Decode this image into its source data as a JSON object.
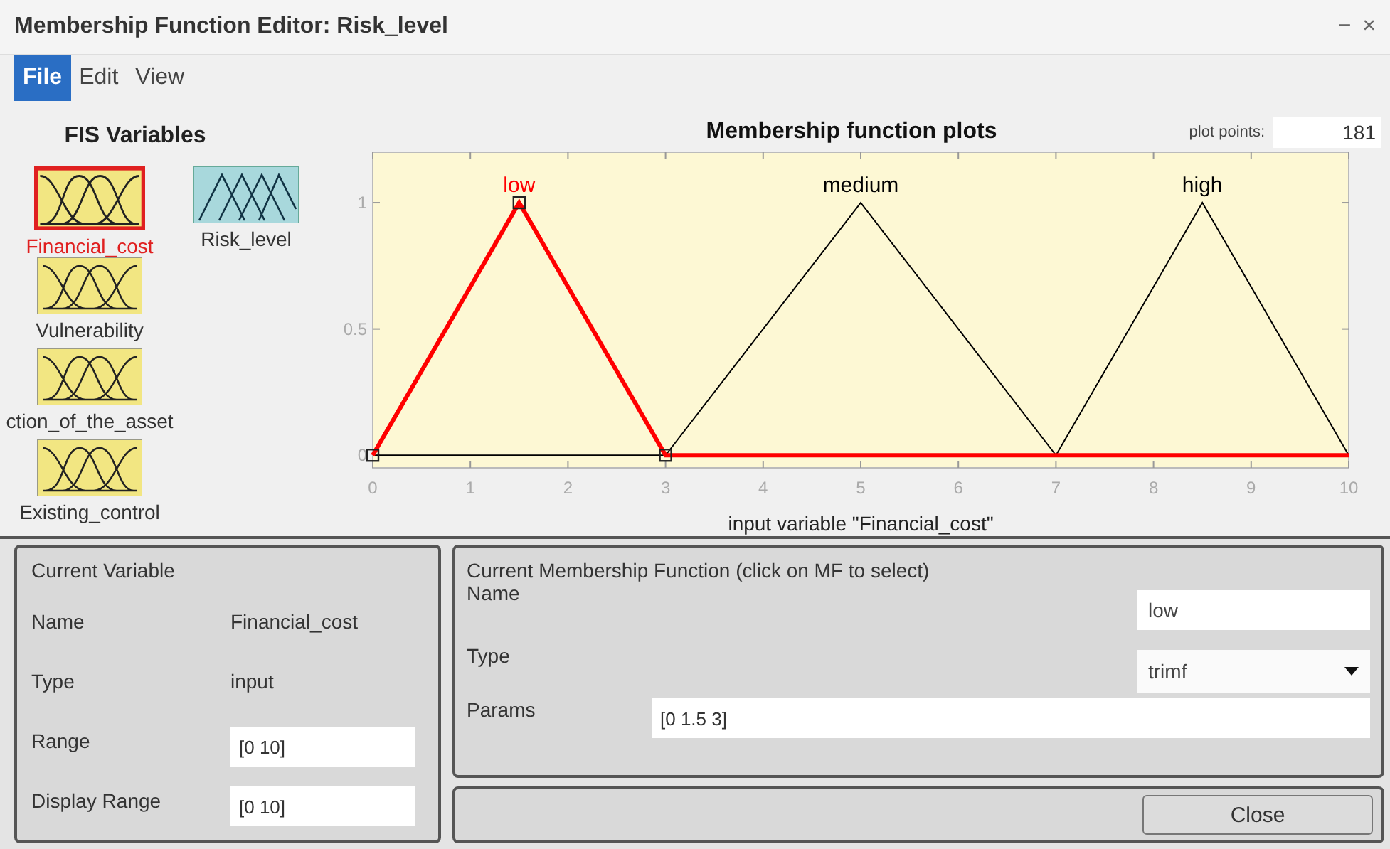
{
  "window": {
    "title": "Membership Function Editor: Risk_level",
    "controls": [
      "−",
      "×"
    ]
  },
  "menu": [
    {
      "label": "File",
      "selected": true
    },
    {
      "label": "Edit",
      "selected": false
    },
    {
      "label": "View",
      "selected": false
    }
  ],
  "fis_variables": {
    "title": "FIS Variables",
    "items": [
      {
        "name": "Financial_cost",
        "kind": "input",
        "selected": true
      },
      {
        "name": "Risk_level",
        "kind": "output",
        "selected": false
      },
      {
        "name": "Vulnerability",
        "kind": "input",
        "selected": false
      },
      {
        "name": "ction_of_the_asset",
        "kind": "input",
        "selected": false
      },
      {
        "name": "Existing_control",
        "kind": "input",
        "selected": false
      }
    ]
  },
  "plot": {
    "plot_points_label": "plot points:",
    "plot_points": "181",
    "chart_data": {
      "type": "line",
      "title": "Membership function plots",
      "xlabel": "input variable \"Financial_cost\"",
      "x": [
        0,
        1.5,
        3,
        5,
        7,
        8.5,
        10
      ],
      "series": [
        {
          "name": "low",
          "color": "#ff0000",
          "values": [
            0,
            1,
            0,
            0,
            0,
            0,
            0
          ]
        },
        {
          "name": "medium",
          "color": "#000000",
          "values": [
            null,
            null,
            0,
            1,
            0,
            null,
            null
          ]
        },
        {
          "name": "high",
          "color": "#000000",
          "values": [
            null,
            null,
            null,
            null,
            0,
            1,
            0
          ]
        }
      ],
      "xlim": [
        0,
        10
      ],
      "ylim": [
        -0.05,
        1.2
      ],
      "xticks": [
        0,
        1,
        2,
        3,
        4,
        5,
        6,
        7,
        8,
        9,
        10
      ],
      "yticks": [
        0,
        0.5,
        1
      ]
    }
  },
  "current_variable": {
    "title": "Current Variable",
    "fields": [
      {
        "label": "Name",
        "value": "Financial_cost",
        "kind": "text"
      },
      {
        "label": "Type",
        "value": "input",
        "kind": "text"
      },
      {
        "label": "Range",
        "value": "[0 10]",
        "kind": "input"
      },
      {
        "label": "Display Range",
        "value": "[0 10]",
        "kind": "input"
      }
    ]
  },
  "current_mf": {
    "title": "Current Membership Function (click on MF to select)",
    "name_label": "Name",
    "name": "low",
    "type_label": "Type",
    "type": "trimf",
    "params_label": "Params",
    "params": "[0 1.5 3]"
  },
  "close_button": "Close"
}
